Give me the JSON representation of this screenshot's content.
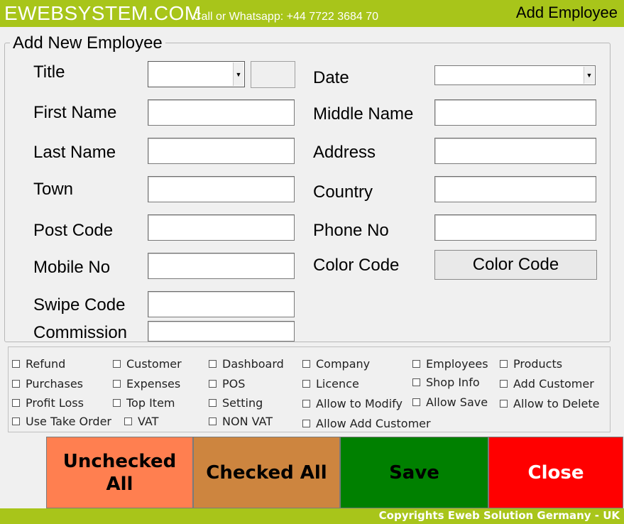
{
  "header": {
    "brand": "EWEBSYSTEM.COM",
    "contact": "Call or Whatsapp: +44 7722 3684 70",
    "window_title": "Add Employee"
  },
  "form": {
    "group_title": "Add New Employee",
    "labels": {
      "title": "Title",
      "first_name": "First Name",
      "last_name": "Last Name",
      "town": "Town",
      "post_code": "Post Code",
      "mobile_no": "Mobile No",
      "swipe_code": "Swipe Code",
      "commission": "Commission",
      "date": "Date",
      "middle_name": "Middle Name",
      "address": "Address",
      "country": "Country",
      "phone_no": "Phone No",
      "color_code": "Color Code"
    },
    "color_code_button": "Color Code"
  },
  "permissions": [
    "Refund",
    "Customer",
    "Dashboard",
    "Company",
    "Employees",
    "Products",
    "Purchases",
    "Expenses",
    "POS",
    "Licence",
    "Shop Info",
    "Add Customer",
    "Profit Loss",
    "Top Item",
    "Setting",
    "Allow to Modify",
    "Allow Save",
    "Allow to Delete",
    "Use Take Order",
    "VAT",
    "NON VAT",
    "Allow Add Customer"
  ],
  "buttons": {
    "unchecked_all": "Unchecked All",
    "checked_all": "Checked All",
    "save": "Save",
    "close": "Close"
  },
  "footer": {
    "copyright": "Copyrights Eweb Solution Germany - UK"
  },
  "colors": {
    "header_green": "#a8c51a",
    "unchecked_bg": "#ff7f50",
    "checked_bg": "#cd853f",
    "save_bg": "#008000",
    "close_bg": "#ff0000"
  }
}
